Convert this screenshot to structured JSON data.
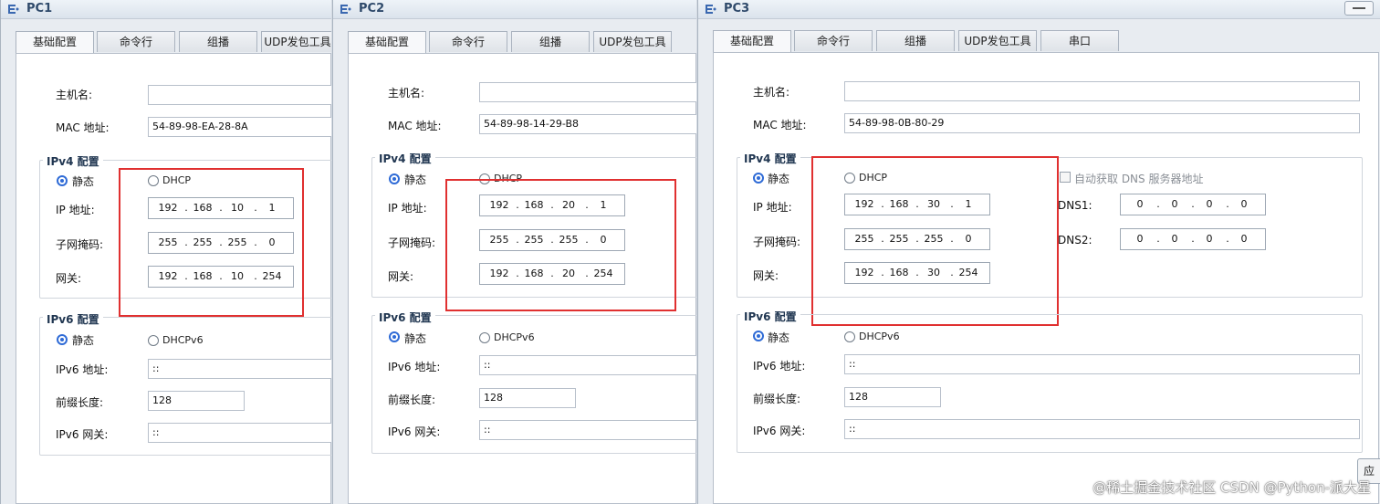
{
  "windows": [
    {
      "title": "PC1",
      "tabs": [
        "基础配置",
        "命令行",
        "组播",
        "UDP发包工具"
      ],
      "hostname_label": "主机名:",
      "hostname_value": "",
      "mac_label": "MAC 地址:",
      "mac_value": "54-89-98-EA-28-8A",
      "ipv4_title": "IPv4 配置",
      "static_label": "静态",
      "dhcp_label": "DHCP",
      "ip_label": "IP 地址:",
      "ip": [
        "192",
        "168",
        "10",
        "1"
      ],
      "mask_label": "子网掩码:",
      "mask": [
        "255",
        "255",
        "255",
        "0"
      ],
      "gw_label": "网关:",
      "gw": [
        "192",
        "168",
        "10",
        "254"
      ],
      "ipv6_title": "IPv6 配置",
      "static6_label": "静态",
      "dhcpv6_label": "DHCPv6",
      "ipv6_label": "IPv6 地址:",
      "ipv6_value": "::",
      "prefix_label": "前缀长度:",
      "prefix_value": "128",
      "ipv6gw_label": "IPv6 网关:",
      "ipv6gw_value": "::"
    },
    {
      "title": "PC2",
      "tabs": [
        "基础配置",
        "命令行",
        "组播",
        "UDP发包工具"
      ],
      "hostname_label": "主机名:",
      "hostname_value": "",
      "mac_label": "MAC 地址:",
      "mac_value": "54-89-98-14-29-B8",
      "ipv4_title": "IPv4 配置",
      "static_label": "静态",
      "dhcp_label": "DHCP",
      "ip_label": "IP 地址:",
      "ip": [
        "192",
        "168",
        "20",
        "1"
      ],
      "mask_label": "子网掩码:",
      "mask": [
        "255",
        "255",
        "255",
        "0"
      ],
      "gw_label": "网关:",
      "gw": [
        "192",
        "168",
        "20",
        "254"
      ],
      "ipv6_title": "IPv6 配置",
      "static6_label": "静态",
      "dhcpv6_label": "DHCPv6",
      "ipv6_label": "IPv6 地址:",
      "ipv6_value": "::",
      "prefix_label": "前缀长度:",
      "prefix_value": "128",
      "ipv6gw_label": "IPv6 网关:",
      "ipv6gw_value": "::"
    },
    {
      "title": "PC3",
      "tabs": [
        "基础配置",
        "命令行",
        "组播",
        "UDP发包工具",
        "串口"
      ],
      "hostname_label": "主机名:",
      "hostname_value": "",
      "mac_label": "MAC 地址:",
      "mac_value": "54-89-98-0B-80-29",
      "ipv4_title": "IPv4 配置",
      "static_label": "静态",
      "dhcp_label": "DHCP",
      "dns_auto_label": "自动获取 DNS 服务器地址",
      "ip_label": "IP 地址:",
      "ip": [
        "192",
        "168",
        "30",
        "1"
      ],
      "mask_label": "子网掩码:",
      "mask": [
        "255",
        "255",
        "255",
        "0"
      ],
      "gw_label": "网关:",
      "gw": [
        "192",
        "168",
        "30",
        "254"
      ],
      "dns1_label": "DNS1:",
      "dns1": [
        "0",
        "0",
        "0",
        "0"
      ],
      "dns2_label": "DNS2:",
      "dns2": [
        "0",
        "0",
        "0",
        "0"
      ],
      "ipv6_title": "IPv6 配置",
      "static6_label": "静态",
      "dhcpv6_label": "DHCPv6",
      "ipv6_label": "IPv6 地址:",
      "ipv6_value": "::",
      "prefix_label": "前缀长度:",
      "prefix_value": "128",
      "ipv6gw_label": "IPv6 网关:",
      "ipv6gw_value": "::",
      "apply_label": "应"
    }
  ],
  "watermark": "@稀土掘金技术社区 CSDN @Python-派大星",
  "colors": {
    "highlight_box": "#e03030",
    "radio_selected": "#2f6bd6",
    "title_text": "#2f4a6b"
  },
  "icons": {
    "window_icon": "ensp-pc-icon",
    "minimize": "minimize-icon"
  }
}
